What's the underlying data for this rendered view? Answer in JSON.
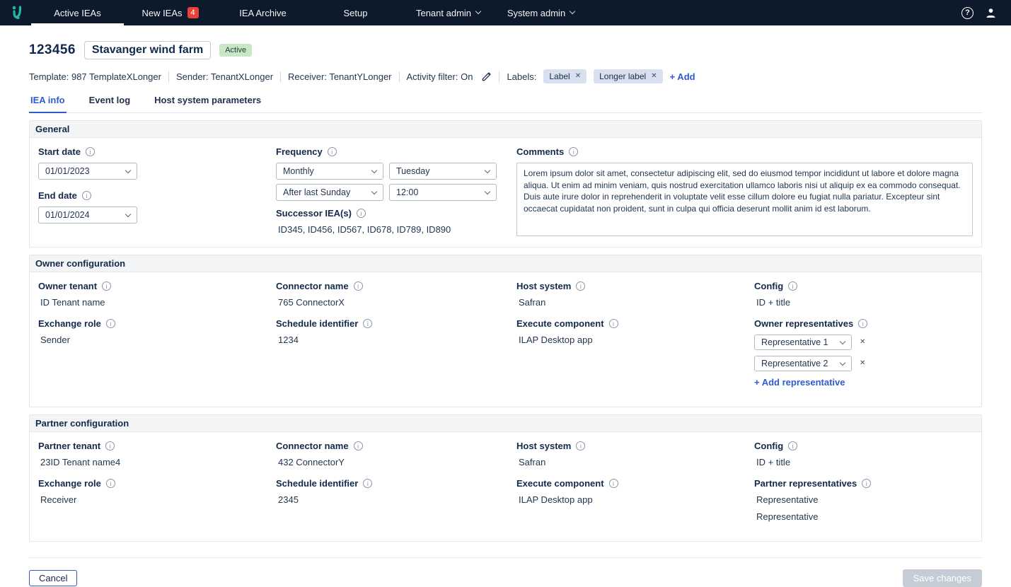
{
  "nav": {
    "items": [
      {
        "label": "Active IEAs"
      },
      {
        "label": "New IEAs",
        "badge": "4"
      },
      {
        "label": "IEA Archive"
      },
      {
        "label": "Setup"
      },
      {
        "label": "Tenant admin"
      },
      {
        "label": "System admin"
      }
    ]
  },
  "header": {
    "iea_id": "123456",
    "title": "Stavanger wind farm",
    "status_badge": "Active",
    "meta": {
      "template": "Template: 987 TemplateXLonger",
      "sender": "Sender: TenantXLonger",
      "receiver": "Receiver: TenantYLonger",
      "activity_filter": "Activity filter: On",
      "labels_caption": "Labels:",
      "labels": [
        {
          "text": "Label"
        },
        {
          "text": "Longer label"
        }
      ],
      "add_label": "+ Add"
    },
    "tabs": [
      {
        "label": "IEA info"
      },
      {
        "label": "Event log"
      },
      {
        "label": "Host system parameters"
      }
    ]
  },
  "general": {
    "section_title": "General",
    "start_date": {
      "label": "Start date",
      "value": "01/01/2023"
    },
    "end_date": {
      "label": "End date",
      "value": "01/01/2024"
    },
    "frequency": {
      "label": "Frequency",
      "interval": "Monthly",
      "weekday": "Tuesday",
      "occurrence": "After last Sunday",
      "time": "12:00"
    },
    "successor": {
      "label": "Successor IEA(s)",
      "value": "ID345, ID456, ID567, ID678, ID789, ID890"
    },
    "comments": {
      "label": "Comments",
      "value": "Lorem ipsum dolor sit amet, consectetur adipiscing elit, sed do eiusmod tempor incididunt ut labore et dolore magna aliqua. Ut enim ad minim veniam, quis nostrud exercitation ullamco laboris nisi ut aliquip ex ea commodo consequat. Duis aute irure dolor in reprehenderit in voluptate velit esse cillum dolore eu fugiat nulla pariatur. Excepteur sint occaecat cupidatat non proident, sunt in culpa qui officia deserunt mollit anim id est laborum."
    }
  },
  "owner": {
    "section_title": "Owner configuration",
    "tenant": {
      "label": "Owner tenant",
      "value": "ID Tenant name"
    },
    "connector": {
      "label": "Connector name",
      "value": "765 ConnectorX"
    },
    "host_system": {
      "label": "Host system",
      "value": "Safran"
    },
    "config": {
      "label": "Config",
      "value": "ID + title"
    },
    "exchange_role": {
      "label": "Exchange role",
      "value": "Sender"
    },
    "schedule": {
      "label": "Schedule identifier",
      "value": "1234"
    },
    "execute_component": {
      "label": "Execute component",
      "value": "ILAP Desktop app"
    },
    "representatives": {
      "label": "Owner representatives",
      "options": [
        {
          "value": "Representative 1"
        },
        {
          "value": "Representative 2"
        }
      ],
      "add_label": "+ Add representative"
    }
  },
  "partner": {
    "section_title": "Partner configuration",
    "tenant": {
      "label": "Partner tenant",
      "value": "23ID Tenant name4"
    },
    "connector": {
      "label": "Connector name",
      "value": "432 ConnectorY"
    },
    "host_system": {
      "label": "Host system",
      "value": "Safran"
    },
    "config": {
      "label": "Config",
      "value": "ID + title"
    },
    "exchange_role": {
      "label": "Exchange role",
      "value": "Receiver"
    },
    "schedule": {
      "label": "Schedule identifier",
      "value": "2345"
    },
    "execute_component": {
      "label": "Execute component",
      "value": "ILAP Desktop app"
    },
    "representatives": {
      "label": "Partner representatives",
      "values": [
        {
          "value": "Representative"
        },
        {
          "value": "Representative"
        }
      ]
    }
  },
  "footer": {
    "cancel": "Cancel",
    "save": "Save changes"
  },
  "colors": {
    "nav_bg": "#0d1a2b",
    "brand_teal": "#24b7a4",
    "accent_blue": "#2d5bd1",
    "badge_red": "#e8413c",
    "status_green_bg": "#c9e7c6",
    "chip_bg": "#d8e0f0",
    "disabled_button_bg": "#c6ccd5"
  }
}
